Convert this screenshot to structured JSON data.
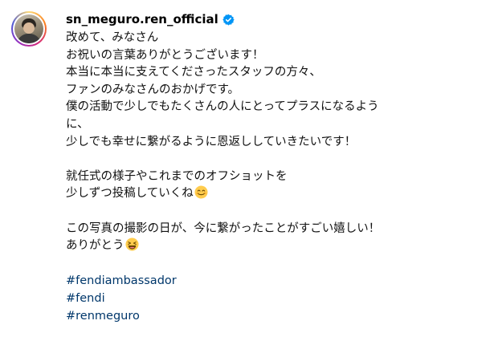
{
  "post": {
    "username": "sn_meguro.ren_official",
    "verified": true,
    "caption_lines_1": [
      "改めて、みなさん",
      "お祝いの言葉ありがとうございます！",
      "本当に本当に支えてくださったスタッフの方々、",
      "ファンのみなさんのおかげです。",
      "僕の活動で少しでもたくさんの人にとってプラスになるよう",
      "に、",
      "少しでも幸せに繋がるように恩返ししていきたいです！"
    ],
    "caption_lines_2": [
      "就任式の様子やこれまでのオフショットを",
      "少しずつ投稿していくね"
    ],
    "caption_lines_3": [
      "この写真の撮影の日が、今に繋がったことがすごい嬉しい！",
      "ありがとう"
    ],
    "hashtags": [
      "#fendiambassador",
      "#fendi",
      "#renmeguro"
    ],
    "icons": {
      "verified": "verified-badge-icon",
      "emoji_1": "smiling-face-emoji",
      "emoji_2": "laughing-face-emoji"
    },
    "colors": {
      "verified_badge": "#0095f6",
      "hashtag": "#00376b",
      "emoji_face": "#ffcc4d"
    }
  }
}
